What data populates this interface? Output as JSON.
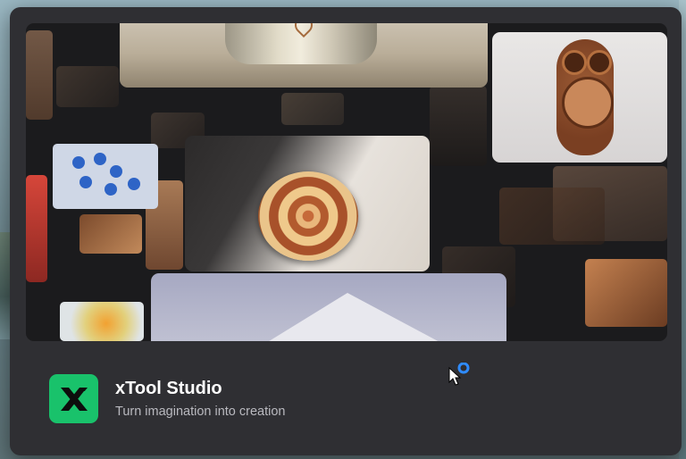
{
  "splash": {
    "app_name": "xTool Studio",
    "tagline": "Turn imagination into creation",
    "icon": "xtool-logo-icon",
    "accent_color": "#19c26b"
  },
  "hero": {
    "images": [
      "cup-photo",
      "owl-clock-photo",
      "mandala-coin-photo",
      "mountain-model-photo"
    ]
  },
  "cursor": {
    "icon": "busy-cursor-icon",
    "spinner_color": "#2f8bff"
  }
}
